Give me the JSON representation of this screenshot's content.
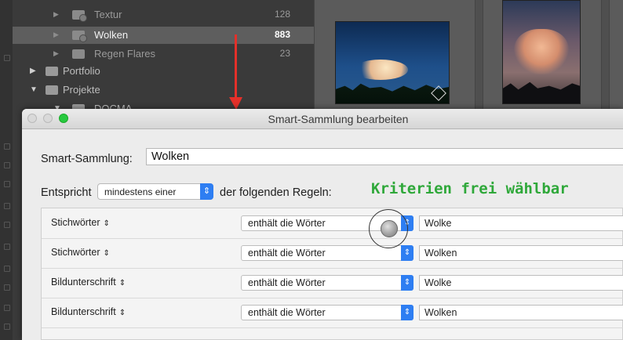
{
  "collections": {
    "items": [
      {
        "label": "Textur",
        "count": "128"
      },
      {
        "label": "Wolken",
        "count": "883"
      },
      {
        "label": "Regen Flares",
        "count": "23"
      },
      {
        "label": "Portfolio",
        "count": ""
      },
      {
        "label": "Projekte",
        "count": ""
      },
      {
        "label": "DOCMA",
        "count": ""
      }
    ]
  },
  "dialog": {
    "title": "Smart-Sammlung bearbeiten",
    "name_label": "Smart-Sammlung:",
    "name_value": "Wolken",
    "match_prefix": "Entspricht",
    "match_option": "mindestens einer",
    "match_suffix": "der folgenden Regeln:",
    "annotation": "Kriterien frei wählbar",
    "rules": [
      {
        "field": "Stichwörter",
        "operator": "enthält die Wörter",
        "value": "Wolke"
      },
      {
        "field": "Stichwörter",
        "operator": "enthält die Wörter",
        "value": "Wolken"
      },
      {
        "field": "Bildunterschrift",
        "operator": "enthält die Wörter",
        "value": "Wolke"
      },
      {
        "field": "Bildunterschrift",
        "operator": "enthält die Wörter",
        "value": "Wolken"
      }
    ]
  },
  "colors": {
    "accent": "#2e7ef2",
    "arrow": "#e4302a",
    "annotation": "#2fa83a",
    "maximize": "#27c93f"
  }
}
